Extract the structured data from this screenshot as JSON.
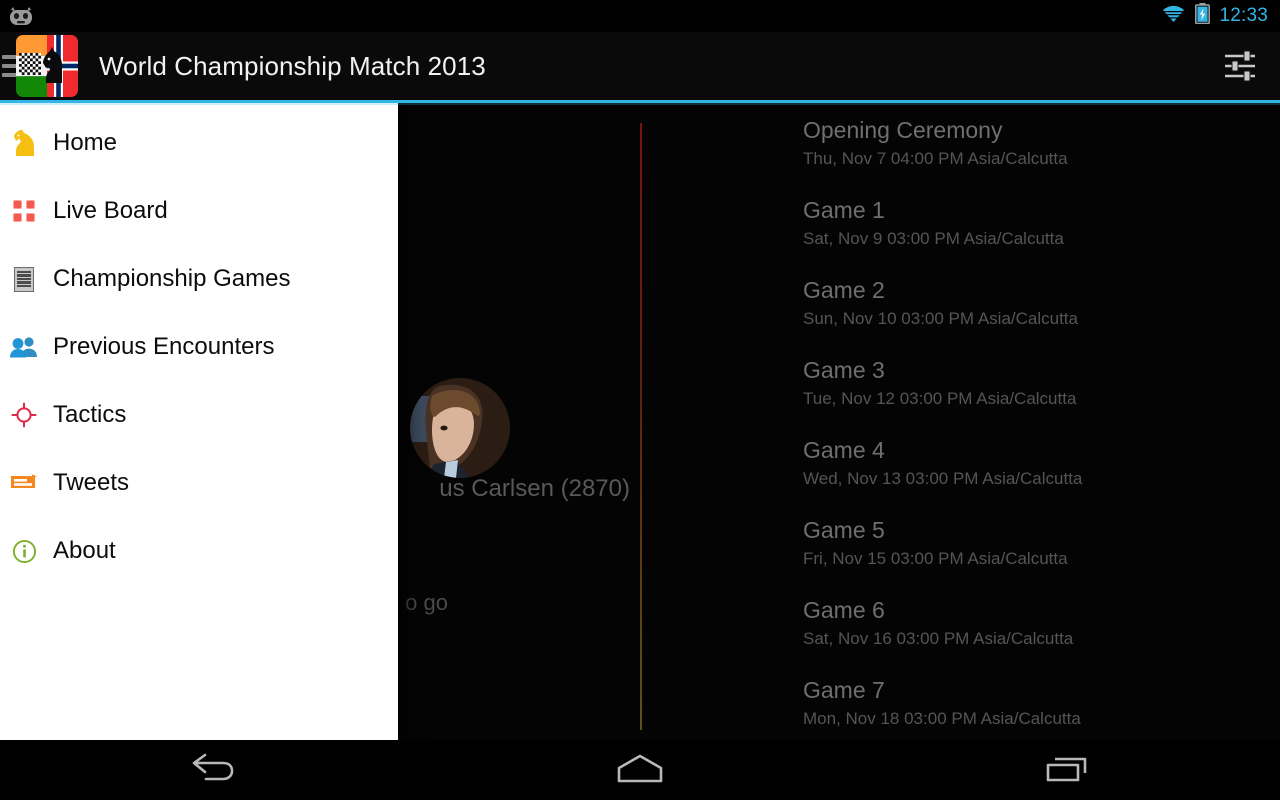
{
  "status_bar": {
    "os_logo_icon": "cyanogenmod-cid-icon",
    "wifi_icon": "wifi-icon",
    "battery_icon": "battery-charging-icon",
    "clock": "12:33",
    "clock_color": "#33b5e5"
  },
  "action_bar": {
    "menu_icon": "hamburger-menu-icon",
    "app_icon": "india-norway-chess-flag-icon",
    "title": "World Championship Match 2013",
    "settings_icon": "settings-sliders-icon",
    "accent_color": "#33b5e5"
  },
  "drawer": {
    "open": true,
    "background": "#ffffff",
    "items": [
      {
        "label": "Home",
        "icon": "chess-knight-icon",
        "icon_color": "#f5c012"
      },
      {
        "label": "Live Board",
        "icon": "grid-board-icon",
        "icon_color": "#f05a4f"
      },
      {
        "label": "Championship Games",
        "icon": "list-lines-icon",
        "icon_color": "#6b6b6b"
      },
      {
        "label": "Previous Encounters",
        "icon": "people-group-icon",
        "icon_color": "#2196d6"
      },
      {
        "label": "Tactics",
        "icon": "target-crosshair-icon",
        "icon_color": "#e0294a"
      },
      {
        "label": "Tweets",
        "icon": "speech-card-icon",
        "icon_color": "#f5871f"
      },
      {
        "label": "About",
        "icon": "info-circle-icon",
        "icon_color": "#7ab02c"
      }
    ]
  },
  "content": {
    "player": {
      "avatar_icon": "player-portrait-avatar",
      "name": "us Carlsen (2870)",
      "subtext": "o go"
    },
    "schedule_title_color": "#6f6f6f",
    "schedule": [
      {
        "title": "Opening Ceremony",
        "datetime": "Thu, Nov 7 04:00 PM Asia/Calcutta"
      },
      {
        "title": "Game 1",
        "datetime": "Sat, Nov 9 03:00 PM Asia/Calcutta"
      },
      {
        "title": "Game 2",
        "datetime": "Sun, Nov 10 03:00 PM Asia/Calcutta"
      },
      {
        "title": "Game 3",
        "datetime": "Tue, Nov 12 03:00 PM Asia/Calcutta"
      },
      {
        "title": "Game 4",
        "datetime": "Wed, Nov 13 03:00 PM Asia/Calcutta"
      },
      {
        "title": "Game 5",
        "datetime": "Fri, Nov 15 03:00 PM Asia/Calcutta"
      },
      {
        "title": "Game 6",
        "datetime": "Sat, Nov 16 03:00 PM Asia/Calcutta"
      },
      {
        "title": "Game 7",
        "datetime": "Mon, Nov 18 03:00 PM Asia/Calcutta"
      }
    ]
  },
  "nav_bar": {
    "back_icon": "back-arrow-icon",
    "home_icon": "home-icon",
    "recents_icon": "recent-apps-icon"
  }
}
